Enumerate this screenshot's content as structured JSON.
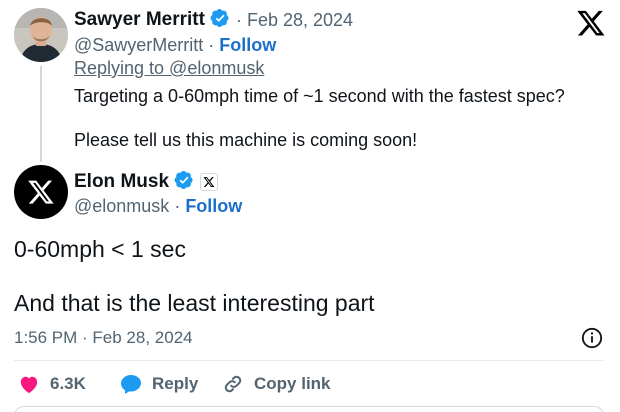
{
  "reply_tweet": {
    "name": "Sawyer Merritt",
    "date": "· Feb 28, 2024",
    "handle": "@SawyerMerritt",
    "follow": "Follow",
    "replying_to": "Replying to @elonmusk",
    "text_line1": "Targeting a 0-60mph time of ~1 second with the fastest spec?",
    "text_line2": "Please tell us this machine is coming soon!"
  },
  "main_tweet": {
    "name": "Elon Musk",
    "handle": "@elonmusk",
    "follow": "Follow",
    "line1": "0-60mph < 1 sec",
    "line2": "And that is the least interesting part",
    "timestamp": "1:56 PM · Feb 28, 2024"
  },
  "actions": {
    "like_count": "6.3K",
    "reply_label": "Reply",
    "copy_label": "Copy link"
  },
  "icons": {
    "verified_color": "#1d9bf0",
    "like_color": "#f91880",
    "reply_color": "#1d9bf0",
    "x_logo": "x-logo-icon",
    "info": "info-icon"
  }
}
